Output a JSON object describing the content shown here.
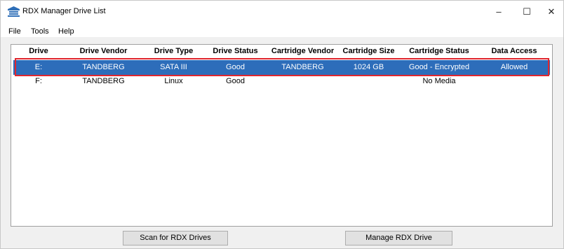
{
  "window": {
    "title": "RDX Manager Drive List"
  },
  "menu": {
    "file": "File",
    "tools": "Tools",
    "help": "Help"
  },
  "titlebar_buttons": {
    "minimize": "–",
    "maximize": "☐",
    "close": "✕"
  },
  "table": {
    "columns": [
      "Drive",
      "Drive Vendor",
      "Drive Type",
      "Drive Status",
      "Cartridge Vendor",
      "Cartridge Size",
      "Cartridge Status",
      "Data Access"
    ],
    "rows": [
      [
        "E:",
        "TANDBERG",
        "SATA III",
        "Good",
        "TANDBERG",
        "1024 GB",
        "Good - Encrypted",
        "Allowed"
      ],
      [
        "F:",
        "TANDBERG",
        "Linux",
        "Good",
        "",
        "",
        "No Media",
        ""
      ]
    ],
    "selected_row": 0
  },
  "buttons": {
    "scan": "Scan for RDX Drives",
    "manage": "Manage RDX Drive"
  },
  "colors": {
    "selection": "#2d6dba",
    "highlight_outline": "#e0262e"
  }
}
